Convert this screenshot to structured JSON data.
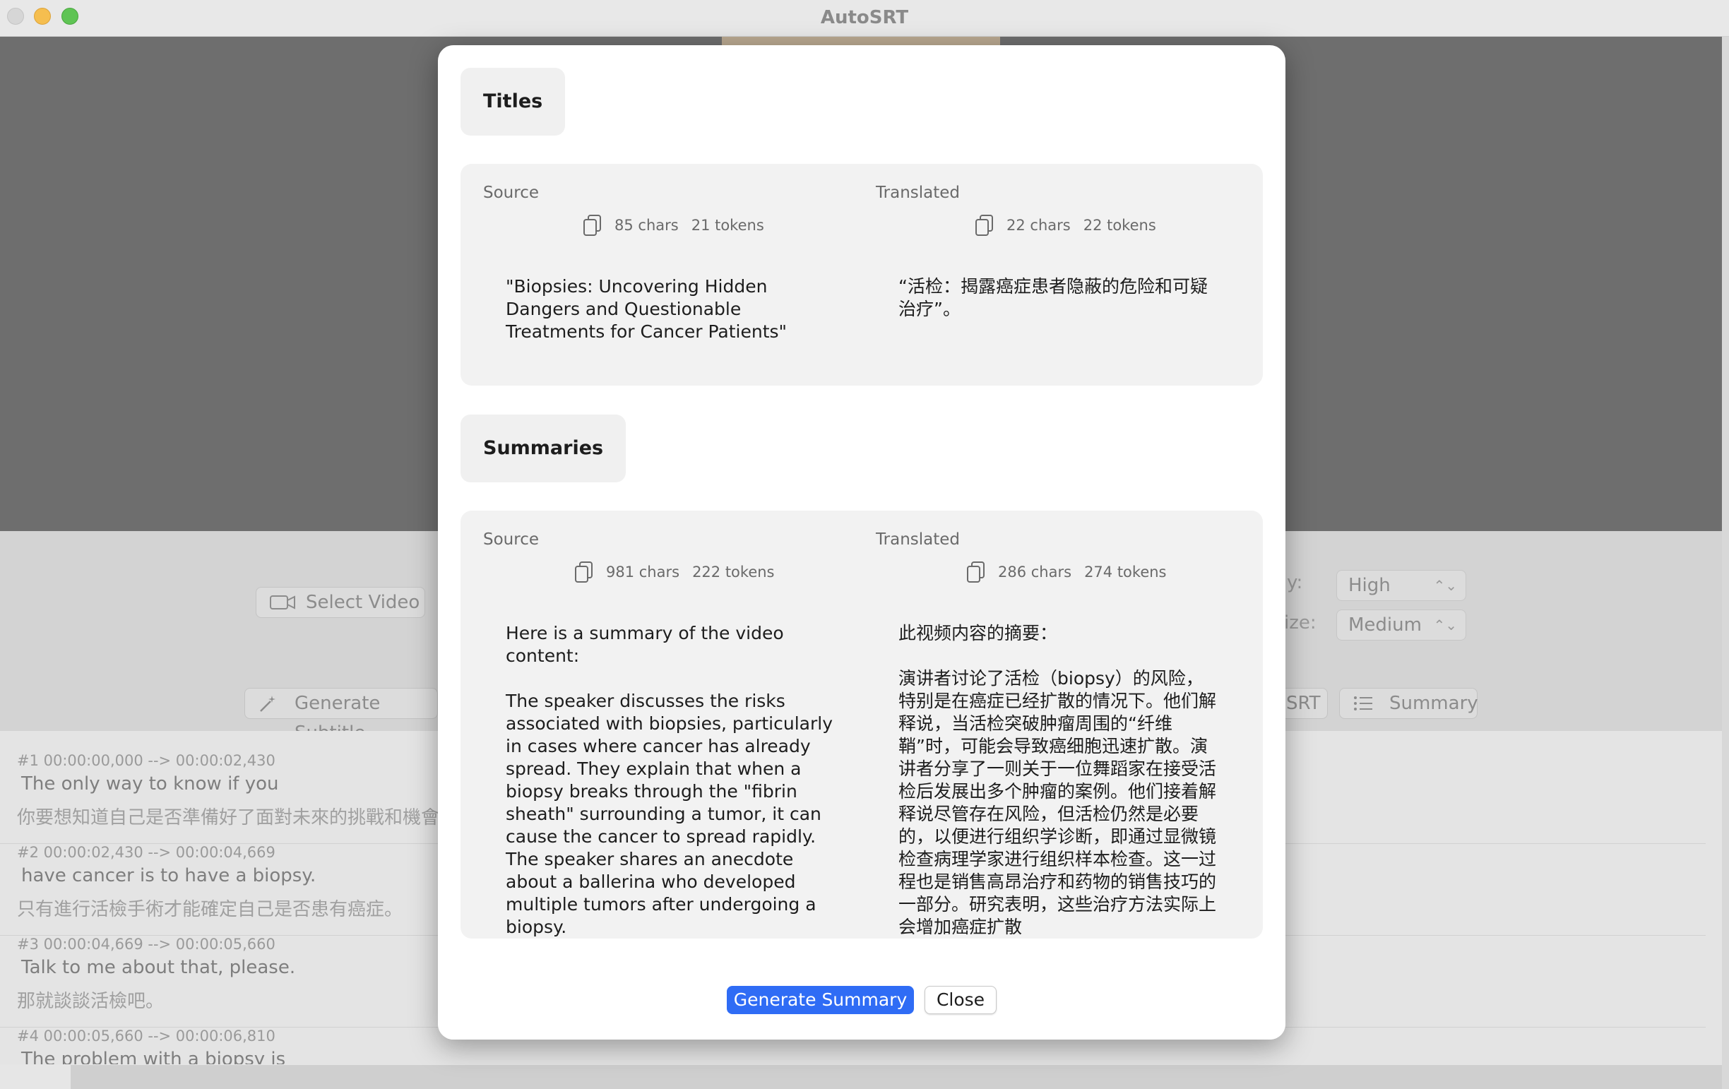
{
  "window": {
    "title": "AutoSRT"
  },
  "controls": {
    "select_video_label": "Select Video",
    "generate_subtitles_label": "Generate Subtitle",
    "srt_label": "SRT",
    "summary_label": "Summary",
    "quality_label_partial": "y:",
    "quality_value": "High",
    "size_label_partial": "ize:",
    "size_value": "Medium"
  },
  "subtitles": [
    {
      "time": "#1 00:00:00,000 --> 00:00:02,430",
      "source": "The only way to know if you",
      "translated": "你要想知道自己是否準備好了面對未來的挑戰和機會"
    },
    {
      "time": "#2 00:00:02,430 --> 00:00:04,669",
      "source": "have cancer is to have a biopsy.",
      "translated": "只有進行活檢手術才能確定自己是否患有癌症。"
    },
    {
      "time": "#3 00:00:04,669 --> 00:00:05,660",
      "source": "Talk to me about that, please.",
      "translated": "那就談談活檢吧。"
    },
    {
      "time": "#4 00:00:05,660 --> 00:00:06,810",
      "source": "The problem with a biopsy is",
      "translated": ""
    }
  ],
  "modal": {
    "titles": {
      "heading": "Titles",
      "source": {
        "label": "Source",
        "chars": "85 chars",
        "tokens": "21 tokens",
        "text": "\"Biopsies: Uncovering Hidden Dangers and Questionable Treatments for Cancer Patients\""
      },
      "translated": {
        "label": "Translated",
        "chars": "22 chars",
        "tokens": "22 tokens",
        "text": "“活检：揭露癌症患者隐蔽的危险和可疑治疗”。"
      }
    },
    "summaries": {
      "heading": "Summaries",
      "source": {
        "label": "Source",
        "chars": "981 chars",
        "tokens": "222 tokens",
        "text": "Here is a summary of the video content:\n\nThe speaker discusses the risks associated with biopsies, particularly in cases where cancer has already spread. They explain that when a biopsy breaks through the \"fibrin sheath\" surrounding a tumor, it can cause the cancer to spread rapidly. The speaker shares an anecdote about a ballerina who developed multiple tumors after undergoing a biopsy."
      },
      "translated": {
        "label": "Translated",
        "chars": "286 chars",
        "tokens": "274 tokens",
        "text": "此视频内容的摘要：\n\n演讲者讨论了活检（biopsy）的风险，特别是在癌症已经扩散的情况下。他们解释说，当活检突破肿瘤周围的“纤维鞘”时，可能会导致癌细胞迅速扩散。演讲者分享了一则关于一位舞蹈家在接受活检后发展出多个肿瘤的案例。他们接着解释说尽管存在风险，但活检仍然是必要的，以便进行组织学诊断，即通过显微镜检查病理学家进行组织样本检查。这一过程也是销售高昂治疗和药物的销售技巧的一部分。研究表明，这些治疗方法实际上会增加癌症扩散"
      }
    },
    "buttons": {
      "generate_summary": "Generate Summary",
      "close": "Close"
    }
  }
}
